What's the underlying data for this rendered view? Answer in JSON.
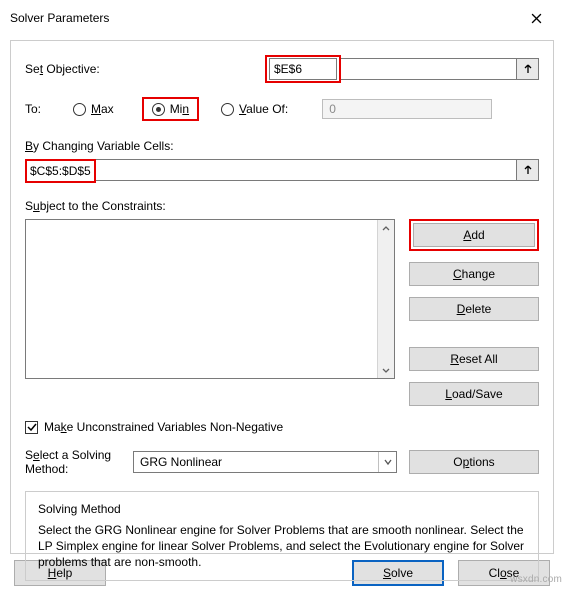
{
  "title": "Solver Parameters",
  "objective": {
    "label_pre": "Se",
    "label_u": "t",
    "label_post": " Objective:",
    "value": "$E$6"
  },
  "to": {
    "label": "To:",
    "max": {
      "u": "M",
      "post": "ax"
    },
    "min": {
      "pre": "Mi",
      "u": "n"
    },
    "valueof": {
      "u": "V",
      "post": "alue Of:",
      "input": "0"
    },
    "selected": "min"
  },
  "cells": {
    "u": "B",
    "post": "y Changing Variable Cells:",
    "value": "$C$5:$D$5"
  },
  "constraints": {
    "label_pre": "S",
    "label_u": "u",
    "label_post": "bject to the Constraints:"
  },
  "buttons": {
    "add": {
      "u": "A",
      "post": "dd"
    },
    "change": {
      "u": "C",
      "post": "hange"
    },
    "delete": {
      "u": "D",
      "post": "elete"
    },
    "resetall": {
      "u": "R",
      "post": "eset All"
    },
    "loadsave": {
      "u": "L",
      "post": "oad/Save"
    },
    "options": {
      "pre": "O",
      "u": "p",
      "post": "tions"
    },
    "help": {
      "u": "H",
      "post": "elp"
    },
    "solve": {
      "u": "S",
      "post": "olve"
    },
    "close": {
      "pre": "Cl",
      "u": "o",
      "post": "se"
    }
  },
  "checkbox": {
    "pre": "Ma",
    "u": "k",
    "post": "e Unconstrained Variables Non-Negative",
    "checked": true
  },
  "method": {
    "label_pre": "S",
    "label_u": "e",
    "label_post": "lect a Solving Method:",
    "value": "GRG Nonlinear"
  },
  "desc": {
    "title": "Solving Method",
    "body": "Select the GRG Nonlinear engine for Solver Problems that are smooth nonlinear. Select the LP Simplex engine for linear Solver Problems, and select the Evolutionary engine for Solver problems that are non-smooth."
  },
  "watermark": "wsxdn.com"
}
